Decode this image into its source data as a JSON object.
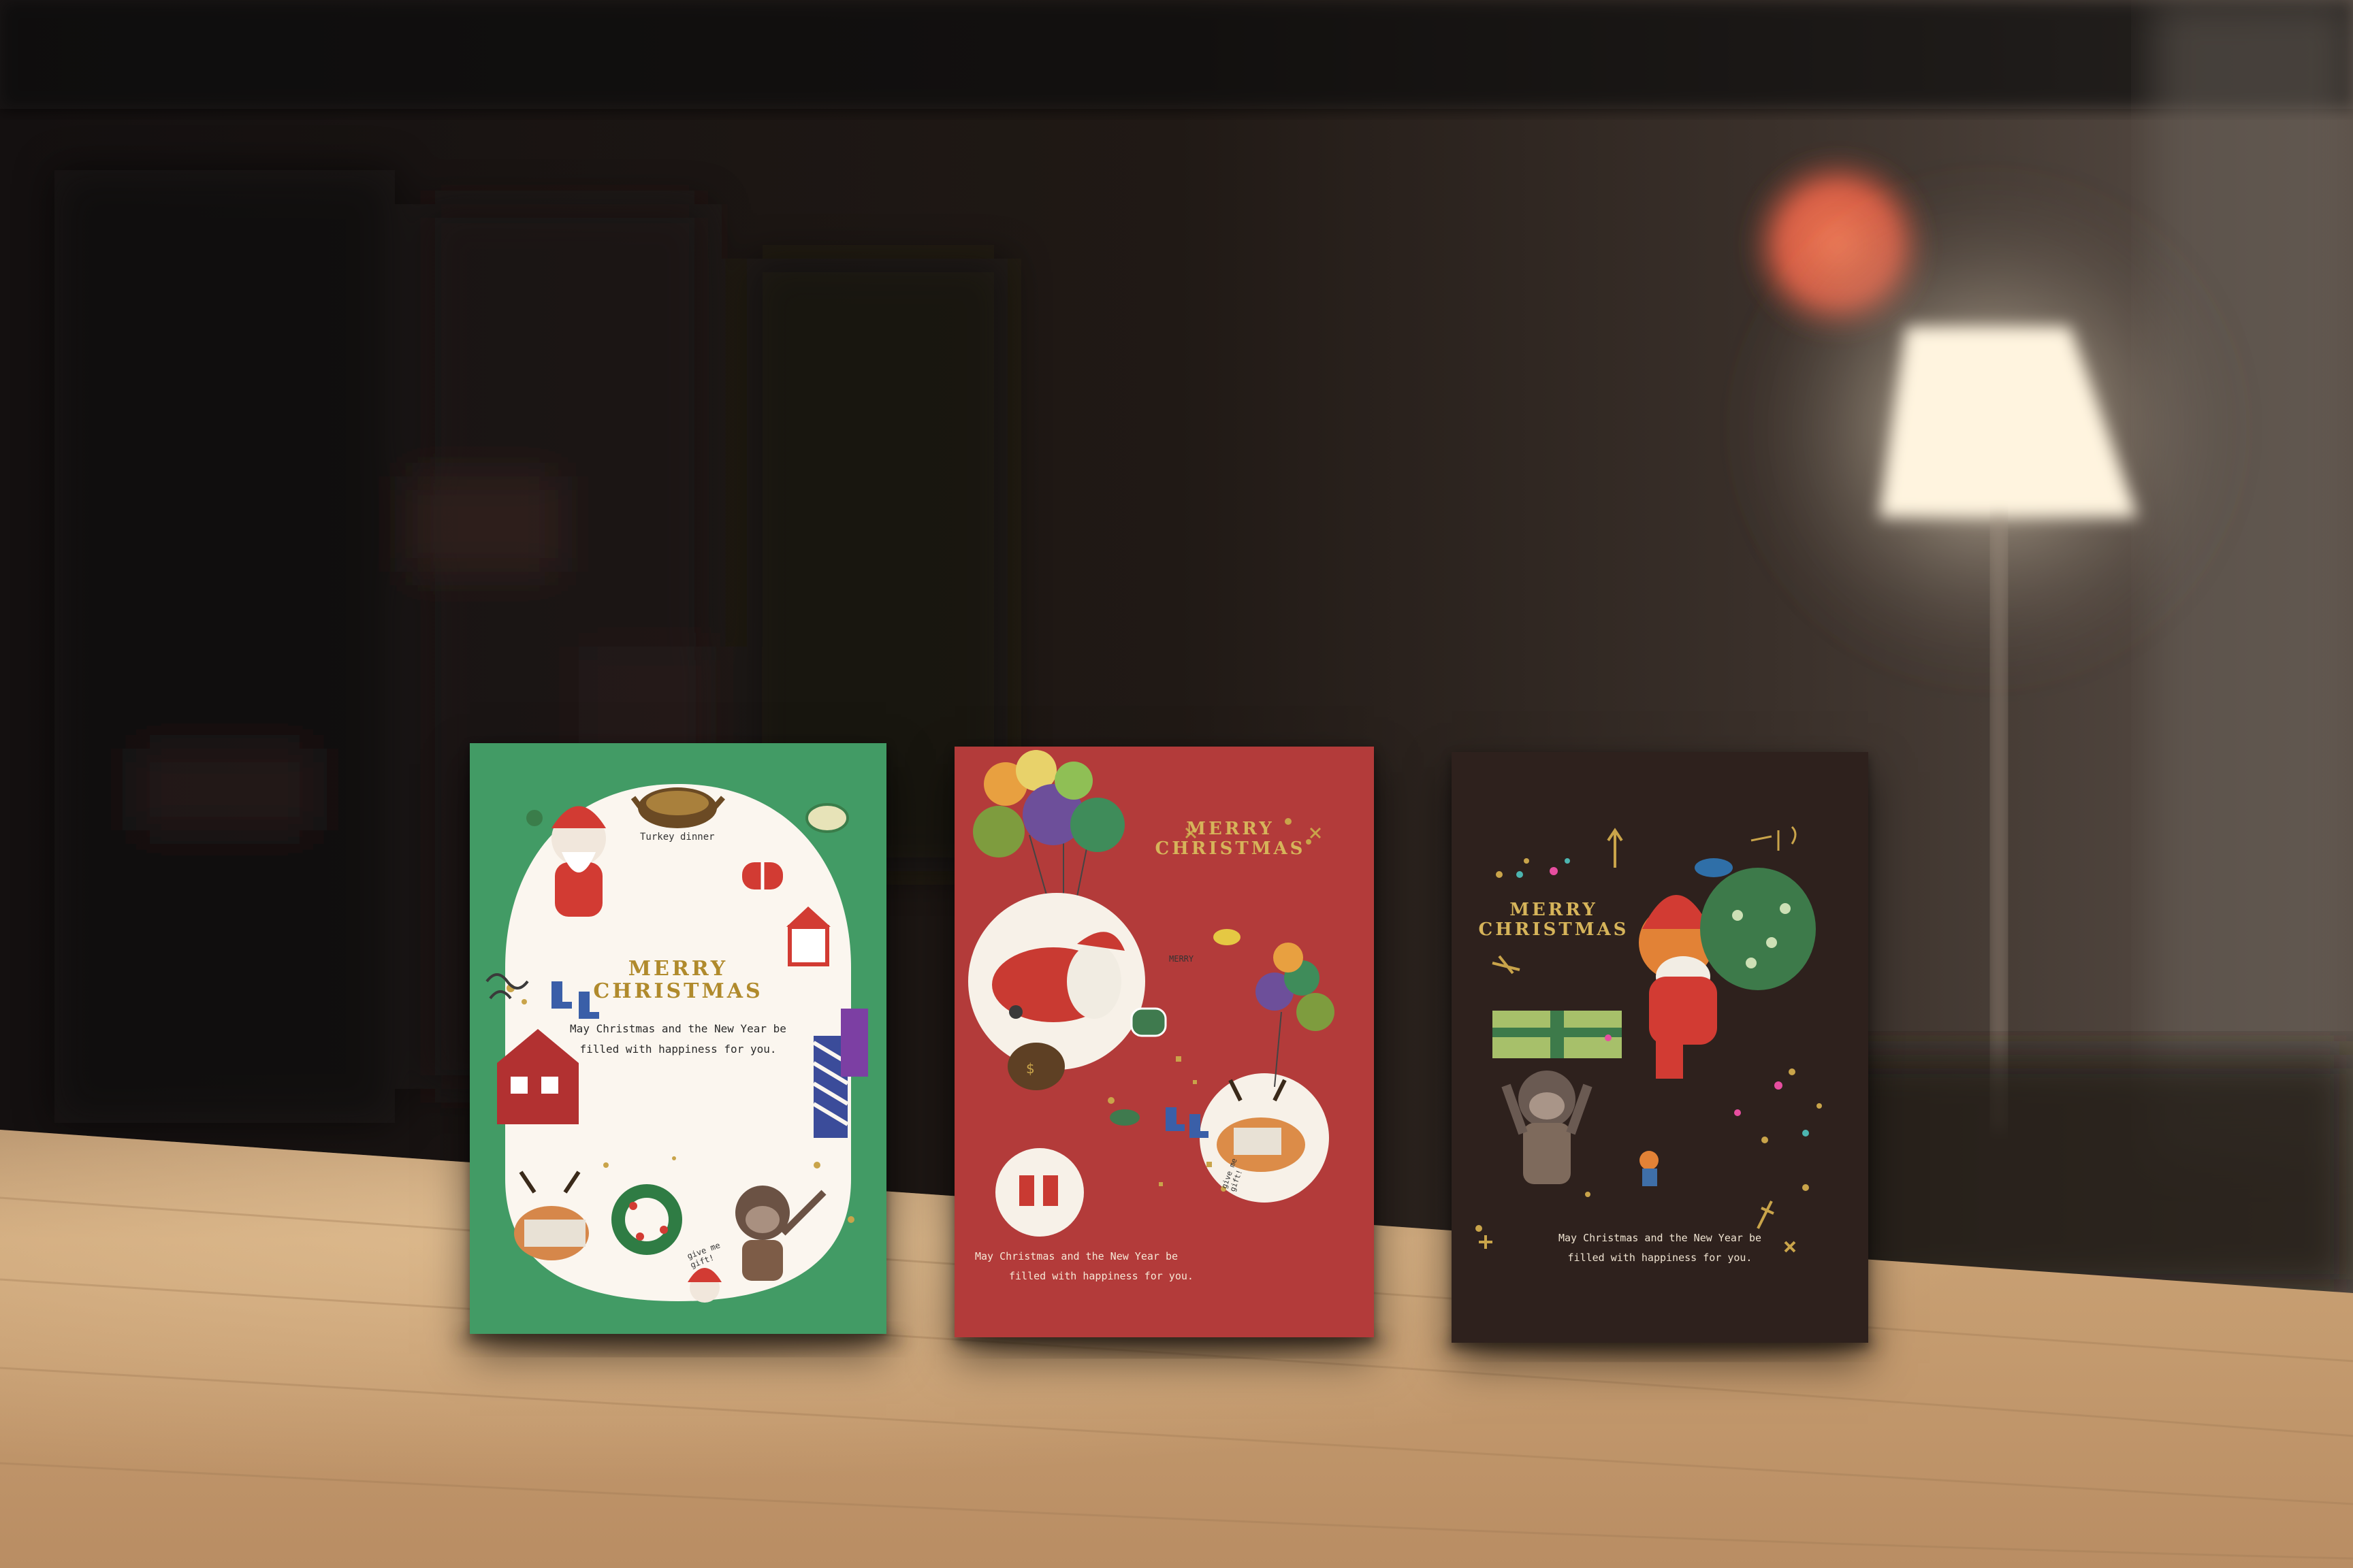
{
  "cards": [
    {
      "color": "#3f9a63",
      "title_line1": "MERRY",
      "title_line2": "CHRISTMAS",
      "message_line1": "May Christmas and the New Year be",
      "message_line2": "filled with happiness for you.",
      "turkey_caption": "Turkey dinner",
      "speech_text": "give me gift!"
    },
    {
      "color": "#b33b3a",
      "title_line1": "MERRY",
      "title_line2": "CHRISTMAS",
      "message_line1": "May Christmas and the New Year be",
      "message_line2": "filled with happiness for you.",
      "shout_text": "MERRY",
      "speech_text": "give me gift!"
    },
    {
      "color": "#2e211d",
      "title_line1": "MERRY",
      "title_line2": "CHRISTMAS",
      "message_line1": "May Christmas and the New Year be",
      "message_line2": "filled with happiness for you."
    }
  ],
  "colors": {
    "gold": "#c9a44a",
    "table": "#c9a174",
    "wall": "#2a211c",
    "lamp": "#fff3dc"
  }
}
